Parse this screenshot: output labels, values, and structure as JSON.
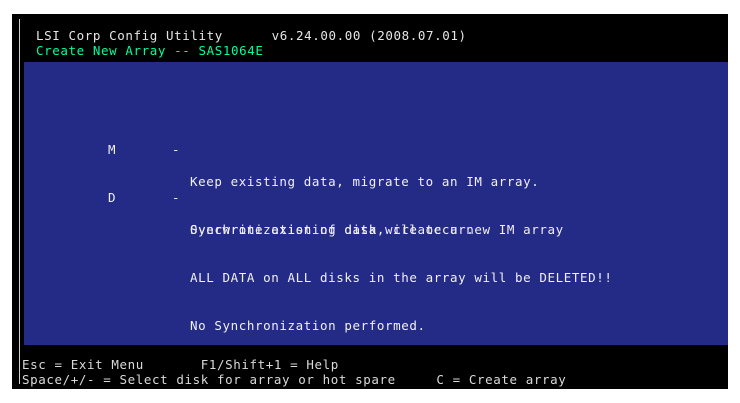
{
  "colors": {
    "background": "#000000",
    "panel": "#242b86",
    "header_text": "#e6e6e6",
    "header_subtitle": "#00ff9c",
    "body_text": "#f0f0f0",
    "footer_text": "#d9d9d9"
  },
  "header": {
    "title": "LSI Corp Config Utility      v6.24.00.00 (2008.07.01)",
    "subtitle": "Create New Array -- SAS1064E"
  },
  "options": [
    {
      "key": "M",
      "dash": "-",
      "lines": [
        "Keep existing data, migrate to an IM array.",
        "Synchronization of disk will occur."
      ]
    },
    {
      "key": "D",
      "dash": "-",
      "lines": [
        "Overwrite existing data, create a new IM array",
        "ALL DATA on ALL disks in the array will be DELETED!!",
        "No Synchronization performed."
      ]
    }
  ],
  "footer": {
    "line1": "Esc = Exit Menu       F1/Shift+1 = Help",
    "line2": "Space/+/- = Select disk for array or hot spare     C = Create array"
  }
}
